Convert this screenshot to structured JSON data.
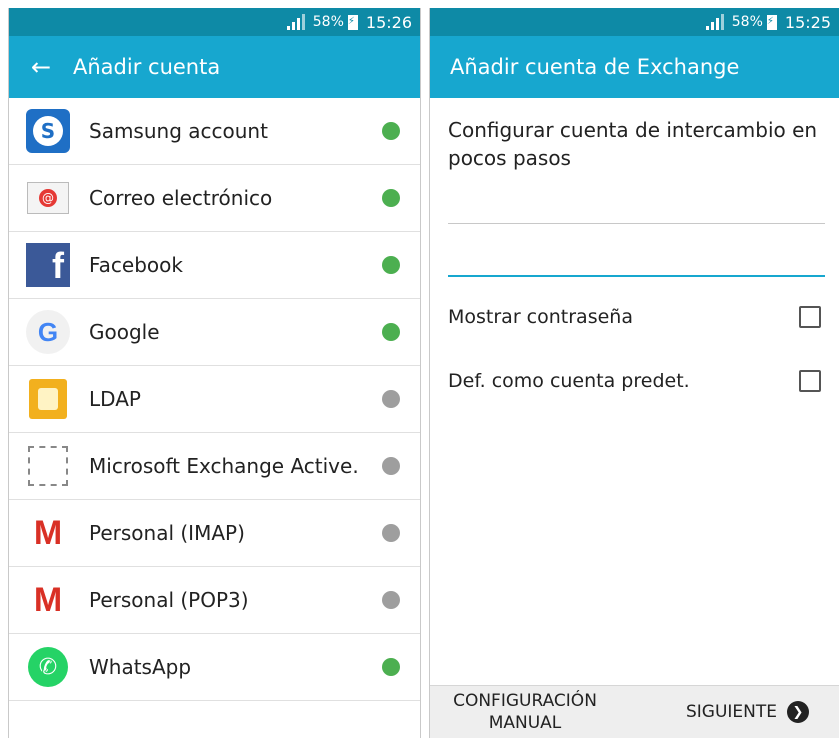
{
  "left": {
    "status": {
      "battery": "58%",
      "time": "15:26"
    },
    "title": "Añadir cuenta",
    "accounts": [
      {
        "label": "Samsung account",
        "icon": "samsung-icon",
        "active": true
      },
      {
        "label": "Correo electrónico",
        "icon": "email-icon",
        "active": true
      },
      {
        "label": "Facebook",
        "icon": "facebook-icon",
        "active": true
      },
      {
        "label": "Google",
        "icon": "google-icon",
        "active": true
      },
      {
        "label": "LDAP",
        "icon": "ldap-icon",
        "active": false
      },
      {
        "label": "Microsoft Exchange Active.",
        "icon": "exchange-icon",
        "active": false
      },
      {
        "label": "Personal (IMAP)",
        "icon": "gmail-icon",
        "active": false
      },
      {
        "label": "Personal (POP3)",
        "icon": "gmail-icon",
        "active": false
      },
      {
        "label": "WhatsApp",
        "icon": "whatsapp-icon",
        "active": true
      }
    ]
  },
  "right": {
    "status": {
      "battery": "58%",
      "time": "15:25"
    },
    "title": "Añadir cuenta de Exchange",
    "intro": "Configurar cuenta de intercambio en pocos pasos",
    "email_field": {
      "value": "",
      "placeholder": ""
    },
    "password_field": {
      "value": "",
      "placeholder": ""
    },
    "show_password": {
      "label": "Mostrar contraseña",
      "checked": false
    },
    "default_account": {
      "label": "Def. como cuenta predet.",
      "checked": false
    },
    "manual_setup": "CONFIGURACIÓN MANUAL",
    "next": "SIGUIENTE"
  },
  "colors": {
    "statusbar": "#0e8aa6",
    "appbar": "#17a7cf",
    "active_dot": "#4caf50",
    "inactive_dot": "#9e9e9e",
    "focus_line": "#17a7cf"
  }
}
